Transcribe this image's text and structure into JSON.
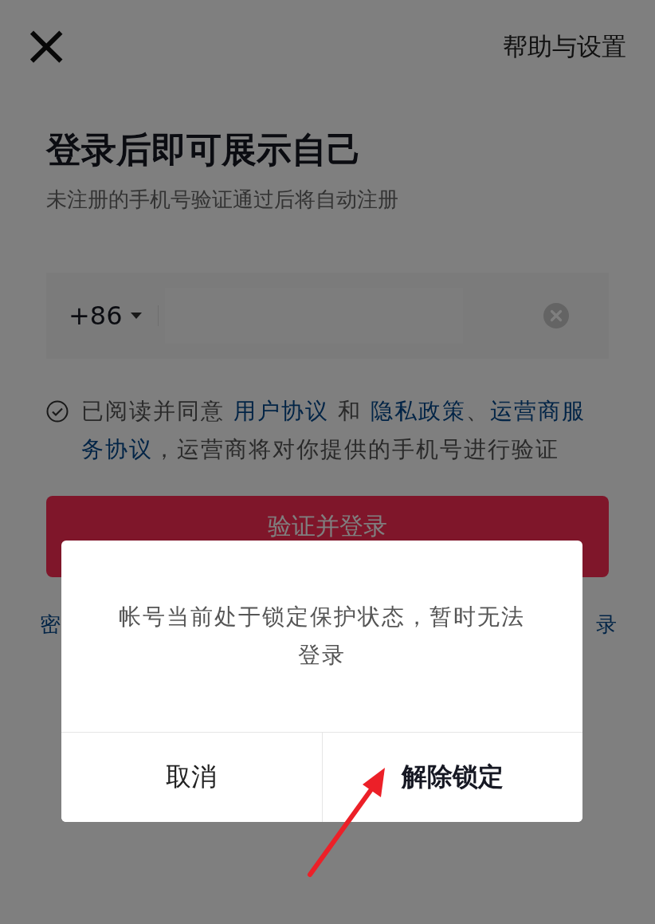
{
  "header": {
    "close_glyph": "×",
    "help_link": "帮助与设置"
  },
  "title": "登录后即可展示自己",
  "subtitle": "未注册的手机号验证通过后将自动注册",
  "phone_field": {
    "country_code": "+86",
    "has_clear": true
  },
  "agreement": {
    "checked": false,
    "parts": [
      {
        "text": "已阅读并同意 ",
        "kind": "text"
      },
      {
        "text": "用户协议",
        "kind": "link"
      },
      {
        "text": " 和 ",
        "kind": "text"
      },
      {
        "text": "隐私政策",
        "kind": "link"
      },
      {
        "text": "、",
        "kind": "text"
      },
      {
        "text": "运营商服",
        "kind": "link"
      },
      {
        "text": "务协议",
        "kind": "link"
      },
      {
        "text": "，运营商将对你提供的手机号进行验证",
        "kind": "text"
      }
    ]
  },
  "login_button": "验证并登录",
  "bottom_links": [
    {
      "text": "密"
    },
    {
      "text": "录"
    }
  ],
  "dialog": {
    "message": "帐号当前处于锁定保护状态，暂时无法登录",
    "buttons": [
      {
        "label": "取消",
        "primary": false
      },
      {
        "label": "解除锁定",
        "primary": true
      }
    ]
  },
  "annotation": {
    "kind": "arrow"
  }
}
